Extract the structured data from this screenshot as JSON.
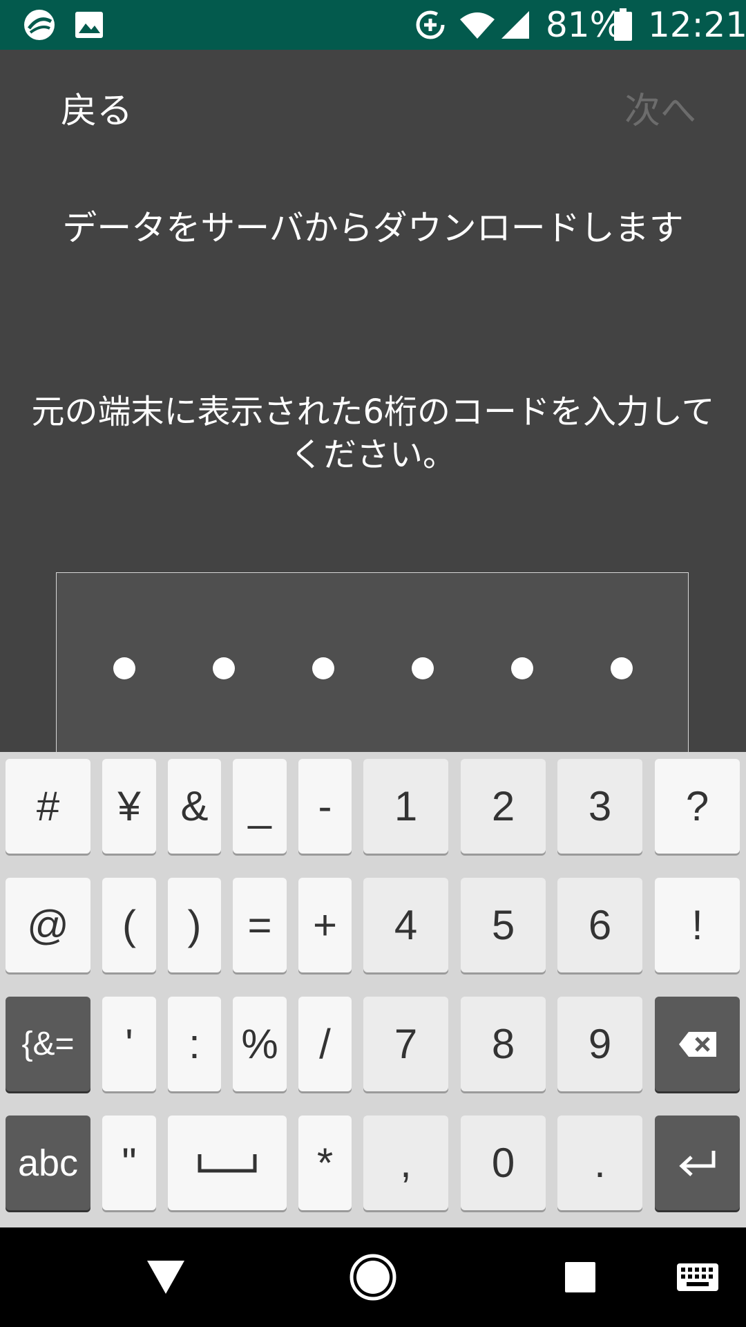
{
  "status_bar": {
    "battery": "81%",
    "time": "12:21",
    "icons": [
      "app-logo-icon",
      "image-icon",
      "data-saver-icon",
      "wifi-icon",
      "signal-icon",
      "battery-icon"
    ]
  },
  "header": {
    "back_label": "戻る",
    "next_label": "次へ"
  },
  "main": {
    "title": "データをサーバからダウンロードします",
    "instruction": "元の端末に表示された6桁のコードを入力してください。",
    "code_dots": 6
  },
  "keyboard": {
    "rows": [
      [
        "#",
        "¥",
        "&",
        "_",
        "-",
        "1",
        "2",
        "3",
        "?"
      ],
      [
        "@",
        "(",
        ")",
        "=",
        "+",
        "4",
        "5",
        "6",
        "!"
      ],
      [
        "{&=",
        "'",
        ":",
        "%",
        "/",
        "7",
        "8",
        "9",
        "backspace-icon"
      ],
      [
        "abc",
        "\"",
        "space-icon",
        "*",
        ",",
        "0",
        ".",
        "enter-icon"
      ]
    ]
  },
  "nav_bar": {
    "icons": [
      "back-triangle-icon",
      "home-circle-icon",
      "recents-square-icon",
      "keyboard-icon"
    ]
  },
  "colors": {
    "status_bar": "#035a4d",
    "background": "#434343",
    "code_box": "#4f4f4f",
    "keyboard_bg": "#d6d6d6",
    "key_light": "#f7f7f7",
    "key_dark": "#5a5a5a"
  }
}
